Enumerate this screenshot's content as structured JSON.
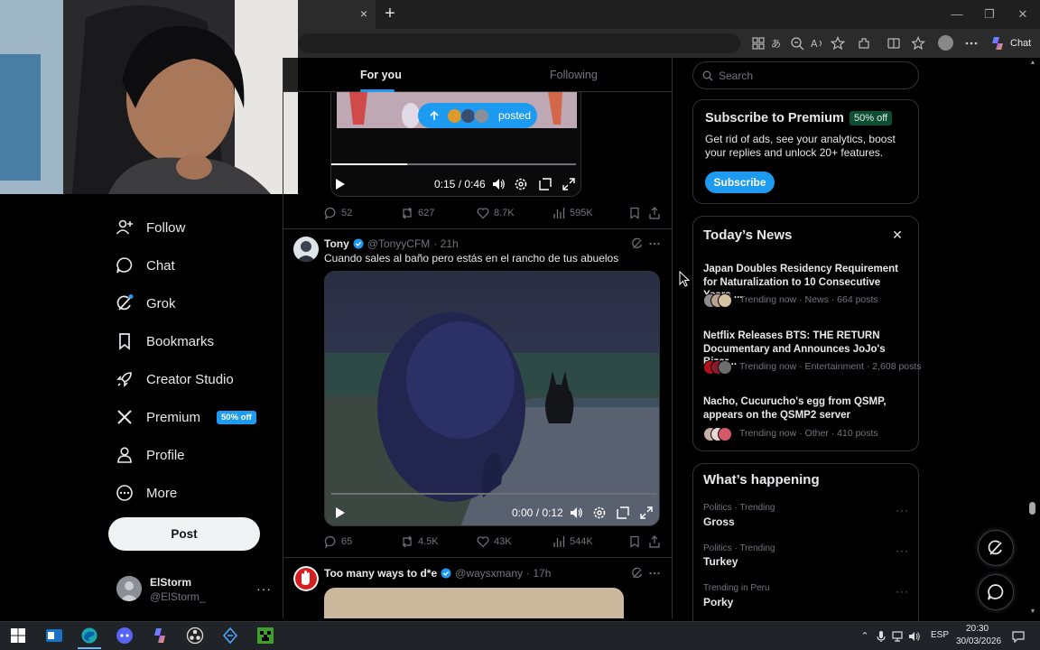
{
  "browser": {
    "tab_close": "×",
    "new_tab": "+",
    "chat_label": "Chat",
    "window_controls": [
      "—",
      "❐",
      "✕"
    ]
  },
  "nav": {
    "items": [
      {
        "label": "Follow",
        "icon": "follow-icon"
      },
      {
        "label": "Chat",
        "icon": "chat-icon"
      },
      {
        "label": "Grok",
        "icon": "grok-icon"
      },
      {
        "label": "Bookmarks",
        "icon": "bookmark-icon"
      },
      {
        "label": "Creator Studio",
        "icon": "rocket-icon"
      },
      {
        "label": "Premium",
        "icon": "x-logo-icon"
      },
      {
        "label": "Profile",
        "icon": "profile-icon"
      },
      {
        "label": "More",
        "icon": "more-circle-icon"
      }
    ],
    "premium_badge": "50% off",
    "post_label": "Post",
    "account": {
      "name": "ElStorm",
      "handle": "@ElStorm_",
      "more": "···"
    }
  },
  "feed": {
    "tabs": {
      "for_you": "For you",
      "following": "Following"
    },
    "posted_pill": "posted",
    "posts": [
      {
        "video_time": "0:15 / 0:46",
        "video_progress": 0.31,
        "stats": {
          "replies": "52",
          "reposts": "627",
          "likes": "8.7K",
          "views": "595K"
        }
      },
      {
        "name": "Tony",
        "handle": "@TonyyCFM",
        "time": "· 21h",
        "text": "Cuando sales al baño pero estás en el rancho de tus abuelos",
        "video_time": "0:00 / 0:12",
        "video_progress": 0.0,
        "stats": {
          "replies": "65",
          "reposts": "4.5K",
          "likes": "43K",
          "views": "544K"
        }
      },
      {
        "name": "Too many ways to d*e",
        "handle": "@waysxmany",
        "time": "· 17h"
      }
    ]
  },
  "sidebar": {
    "search_placeholder": "Search",
    "premium": {
      "title": "Subscribe to Premium",
      "badge": "50% off",
      "desc": "Get rid of ads, see your analytics, boost your replies and unlock 20+ features.",
      "button": "Subscribe"
    },
    "news": {
      "title": "Today’s News",
      "close": "✕",
      "items": [
        {
          "headline": "Japan Doubles Residency Requirement for Naturalization to 10 Consecutive Years ...",
          "meta": "Trending now · News · 664 posts"
        },
        {
          "headline": "Netflix Releases BTS: THE RETURN Documentary and Announces JoJo's Bizar...",
          "meta": "Trending now · Entertainment · 2,608 posts"
        },
        {
          "headline": "Nacho, Cucurucho's egg from QSMP, appears on the QSMP2 server",
          "meta": "Trending now · Other · 410 posts"
        }
      ]
    },
    "happening": {
      "title": "What’s happening",
      "items": [
        {
          "category": "Politics · Trending",
          "name": "Gross"
        },
        {
          "category": "Politics · Trending",
          "name": "Turkey"
        },
        {
          "category": "Trending in Peru",
          "name": "Porky"
        }
      ],
      "more": "···"
    }
  },
  "taskbar": {
    "lang": "ESP",
    "time": "20:30",
    "date": "30/03/2026"
  },
  "colors": {
    "accent": "#1d9bf0",
    "background": "#000000",
    "border": "#2f3336",
    "muted": "#71767b"
  }
}
